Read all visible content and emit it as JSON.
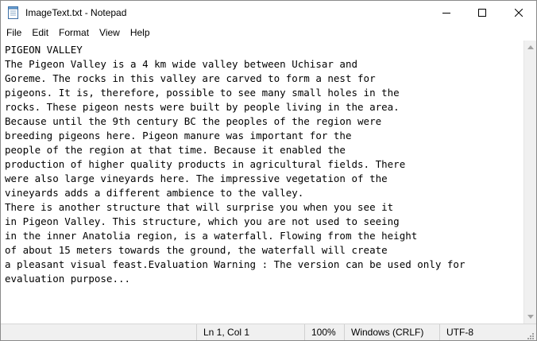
{
  "window": {
    "title": "ImageText.txt - Notepad",
    "controls": {
      "minimize": "minimize-icon",
      "maximize": "maximize-icon",
      "close": "close-icon"
    }
  },
  "menu": {
    "items": [
      "File",
      "Edit",
      "Format",
      "View",
      "Help"
    ]
  },
  "editor": {
    "text": "PIGEON VALLEY\nThe Pigeon Valley is a 4 km wide valley between Uchisar and\nGoreme. The rocks in this valley are carved to form a nest for\npigeons. It is, therefore, possible to see many small holes in the\nrocks. These pigeon nests were built by people living in the area.\nBecause until the 9th century BC the peoples of the region were\nbreeding pigeons here. Pigeon manure was important for the\npeople of the region at that time. Because it enabled the\nproduction of higher quality products in agricultural fields. There\nwere also large vineyards here. The impressive vegetation of the\nvineyards adds a different ambience to the valley.\nThere is another structure that will surprise you when you see it\nin Pigeon Valley. This structure, which you are not used to seeing\nin the inner Anatolia region, is a waterfall. Flowing from the height\nof about 15 meters towards the ground, the waterfall will create\na pleasant visual feast.Evaluation Warning : The version can be used only for\nevaluation purpose..."
  },
  "status": {
    "position": "Ln 1, Col 1",
    "zoom": "100%",
    "line_ending": "Windows (CRLF)",
    "encoding": "UTF-8"
  },
  "colors": {
    "titlebar": "#ffffff",
    "statusbar": "#f0f0f0",
    "text": "#000000"
  }
}
